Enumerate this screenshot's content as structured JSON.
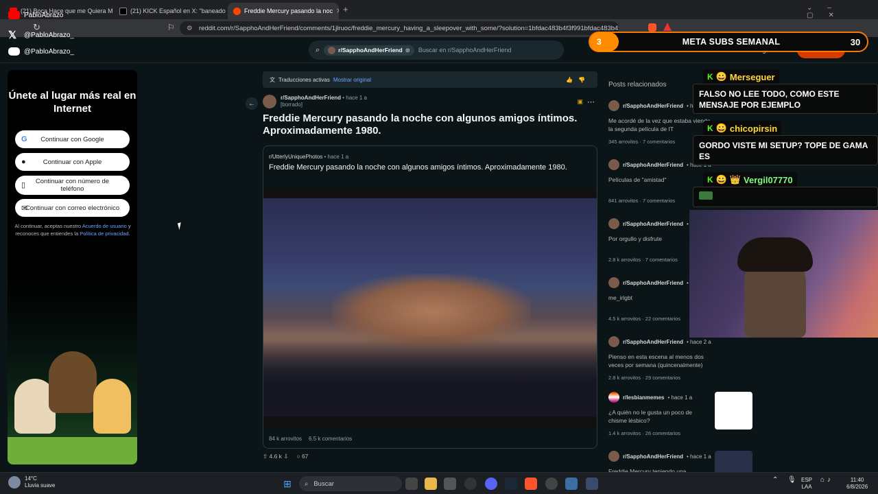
{
  "browser": {
    "tabs": [
      {
        "label": "(21) Boca Hace que me Quiera Mata..."
      },
      {
        "label": "(21) KICK Español en X: \"baneado de"
      },
      {
        "label": "Freddie Mercury pasando la noc"
      }
    ],
    "url": "reddit.com/r/SapphoAndHerFriend/comments/1jlruoc/freddie_mercury_having_a_sleepover_with_some/?solution=1bfdac483b4f3f991bfdac483b4f3..."
  },
  "socials": {
    "youtube": "PabloAbrazo",
    "x": "@PabloAbrazo_",
    "discord": "@PabloAbrazo_"
  },
  "reddit_header": {
    "subreddit_chip": "r/SapphoAndHerFriend",
    "search_placeholder": "Buscar en r/SapphoAndHerFriend",
    "register": "Registrarse",
    "login": "Iniciar sesión"
  },
  "login_panel": {
    "title": "Únete al lugar más real en Internet",
    "google": "Continuar con Google",
    "apple": "Continuar con Apple",
    "phone": "Continuar con número de teléfono",
    "email": "Continuar con correo electrónico",
    "legal_1": "Al continuar, aceptas nuestro ",
    "legal_link_1": "Acuerdo de usuario",
    "legal_2": " y reconoces que entiendes la ",
    "legal_link_2": "Política de privacidad",
    "legal_3": "."
  },
  "translation_bar": {
    "label": "Traducciones activas",
    "link": "Mostrar original"
  },
  "post": {
    "subreddit": "r/SapphoAndHerFriend",
    "time": "• hace 1 a",
    "author": "[borrado]",
    "title": "Freddie Mercury pasando la noche con algunos amigos íntimos. Aproximadamente 1980.",
    "crosspost": {
      "subreddit": "r/UtterlyUniquePhotos",
      "time": "• hace 1 a",
      "title": "Freddie Mercury pasando la noche con algunos amigos íntimos. Aproximadamente 1980.",
      "votes": "84 k arrovitos",
      "comments": "6.5 k comentarios"
    },
    "votes": "4.6 k",
    "comments": "67"
  },
  "related": {
    "heading": "Posts relacionados",
    "items": [
      {
        "sub": "r/SapphoAndHerFriend",
        "time": "• h",
        "title": "Me acordé de la vez que estaba viendo la segunda película de IT",
        "votes": "345 arrovitos",
        "comments": "7 comentarios"
      },
      {
        "sub": "r/SapphoAndHerFriend",
        "time": "• hace 1 a",
        "title": "Películas de \"amistad\"",
        "votes": "841 arrovitos",
        "comments": "7 comentarios"
      },
      {
        "sub": "r/SapphoAndHerFriend",
        "time": "• h",
        "title": "Por orgullo y disfrute",
        "votes": "2.8 k arrovitos",
        "comments": "7 comentarios"
      },
      {
        "sub": "r/SapphoAndHerFriend",
        "time": "• hace 1 a",
        "title": "me_irlgbt",
        "votes": "4.5 k arrovitos",
        "comments": "22 comentarios"
      },
      {
        "sub": "r/SapphoAndHerFriend",
        "time": "• hace 2 a",
        "title": "Pienso en esta escena al menos dos veces por semana (quincenalmente)",
        "votes": "2.8 k arrovitos",
        "comments": "29 comentarios"
      },
      {
        "sub": "r/lesbianmemes",
        "time": "• hace 1 a",
        "title": "¿A quién no le gusta un poco de chisme lésbico?",
        "votes": "1.4 k arrovitos",
        "comments": "26 comentarios"
      },
      {
        "sub": "r/SapphoAndHerFriend",
        "time": "• hace 1 a",
        "title": "Freddie Mercury teniendo una",
        "votes": "",
        "comments": ""
      }
    ]
  },
  "stream_overlay": {
    "meta_left": "3",
    "meta_label": "META SUBS SEMANAL",
    "meta_goal": "30",
    "chat": [
      {
        "user": "Merseguer",
        "message": "FALSO NO LEE TODO, COMO ESTE MENSAJE POR EJEMPLO"
      },
      {
        "user": "chicopirsin",
        "message": "GORDO VISTE MI SETUP? TOPE DE GAMA ES"
      },
      {
        "user": "Vergil07770",
        "message": ""
      }
    ]
  },
  "taskbar": {
    "weather_temp": "14°C",
    "weather_desc": "Lluvia suave",
    "search": "Buscar",
    "lang_1": "ESP",
    "lang_2": "LAA",
    "time": "11:40",
    "date": "6/8/2026"
  }
}
